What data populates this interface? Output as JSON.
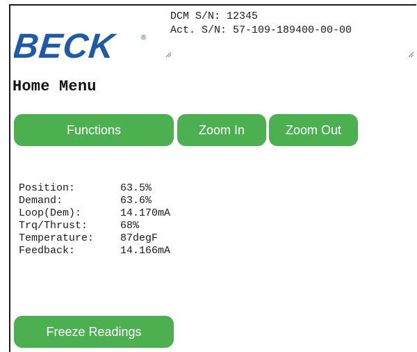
{
  "brand": {
    "logo_text": "BECK",
    "registered_mark": "®"
  },
  "serials": {
    "dcm_line": "DCM S/N: 12345",
    "act_line": "Act. S/N: 57-109-189400-00-00"
  },
  "page": {
    "title": "Home Menu"
  },
  "buttons": {
    "functions": "Functions",
    "zoom_in": "Zoom In",
    "zoom_out": "Zoom Out",
    "freeze": "Freeze Readings"
  },
  "readings": [
    {
      "label": "Position:",
      "value": "63.5%"
    },
    {
      "label": "Demand:",
      "value": "63.6%"
    },
    {
      "label": "Loop(Dem):",
      "value": "14.170mA"
    },
    {
      "label": "Trq/Thrust:",
      "value": "68%"
    },
    {
      "label": "Temperature:",
      "value": "87degF"
    },
    {
      "label": "Feedback:",
      "value": "14.166mA"
    }
  ],
  "colors": {
    "button_green": "#4caf50",
    "logo_blue": "#1f5aa6"
  }
}
